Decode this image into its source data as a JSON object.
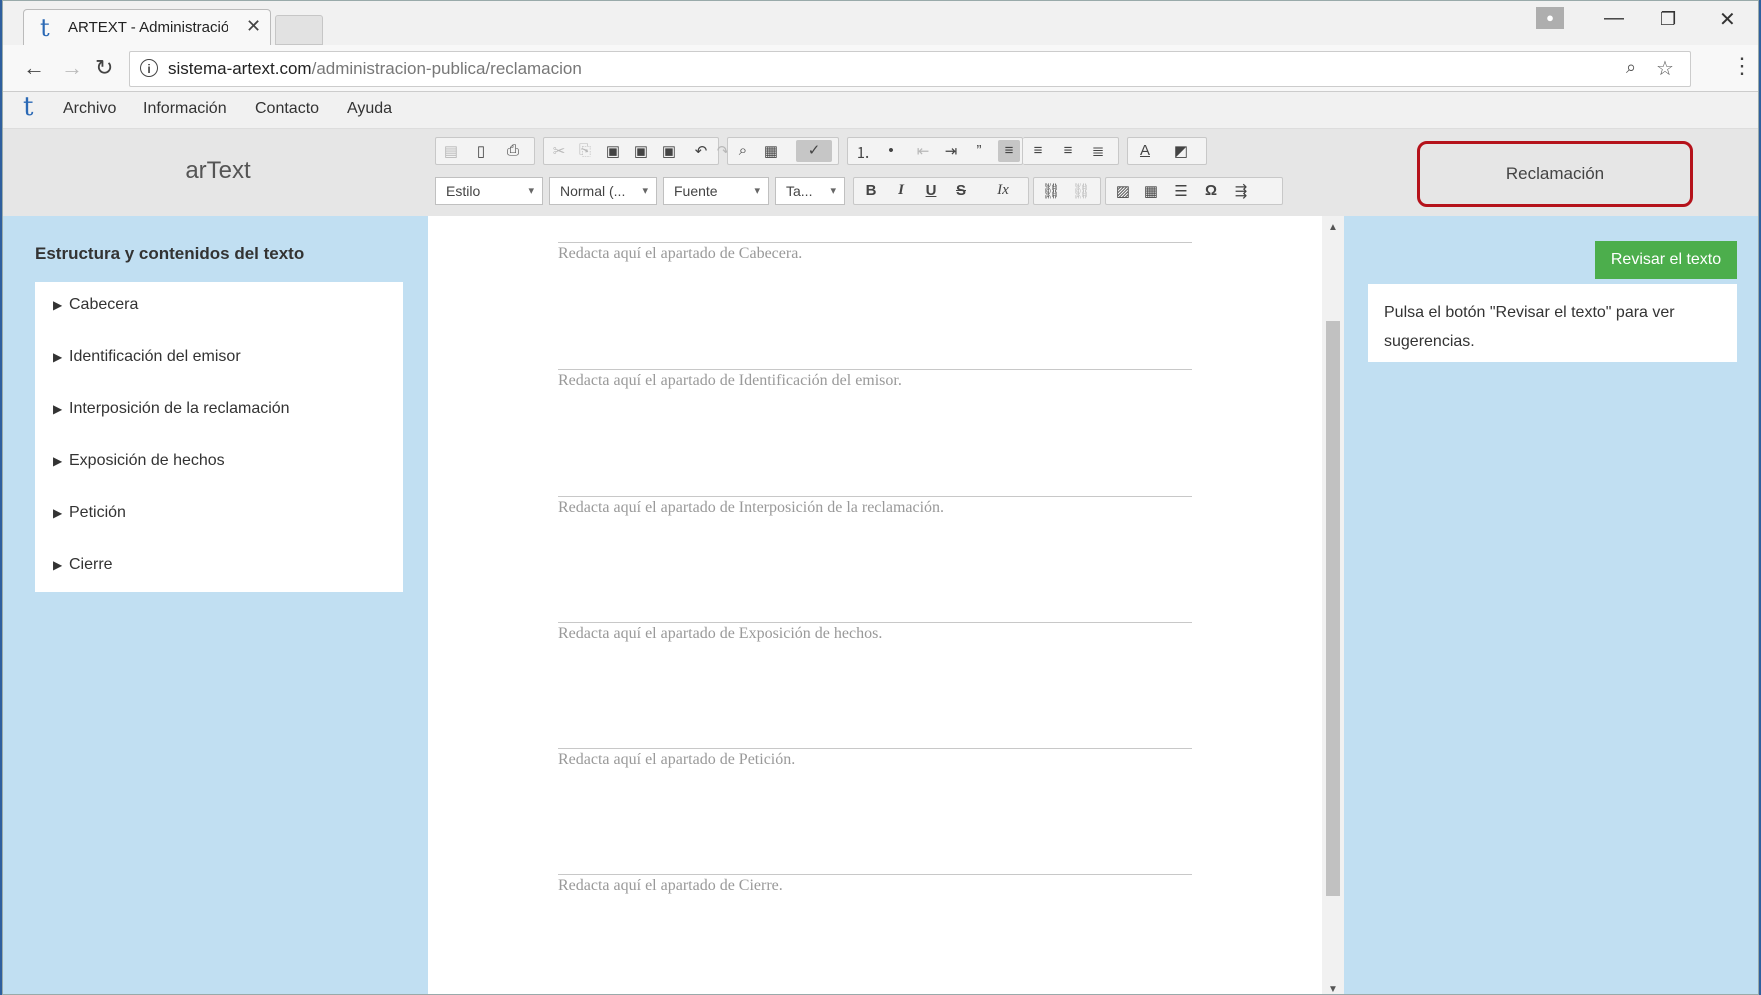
{
  "browser": {
    "tab_title": "ARTEXT - Administración",
    "tab_icon": "t",
    "url_host": "sistema-artext.com",
    "url_path": "/administracion-publica/reclamacion"
  },
  "menu": {
    "logo": "t",
    "items": [
      "Archivo",
      "Información",
      "Contacto",
      "Ayuda"
    ]
  },
  "header": {
    "app_name": "arText",
    "mode_label": "Reclamación",
    "accent_color": "#b5121b"
  },
  "editor_toolbar": {
    "style_label": "Estilo",
    "format_label": "Normal (...",
    "font_label": "Fuente",
    "size_label": "Ta...",
    "bold": "B",
    "italic": "I",
    "underline": "U",
    "strike": "S",
    "omega": "Ω"
  },
  "left_panel": {
    "title": "Estructura y contenidos del texto",
    "items": [
      "Cabecera",
      "Identificación del emisor",
      "Interposición de la reclamación",
      "Exposición de hechos",
      "Petición",
      "Cierre"
    ]
  },
  "editor": {
    "sections": [
      "Redacta aquí el apartado de Cabecera.",
      "Redacta aquí el apartado de Identificación del emisor.",
      "Redacta aquí el apartado de Interposición de la reclamación.",
      "Redacta aquí el apartado de Exposición de hechos.",
      "Redacta aquí el apartado de Petición.",
      "Redacta aquí el apartado de Cierre."
    ]
  },
  "right_panel": {
    "review_button": "Revisar el texto",
    "review_button_color": "#4cae4c",
    "suggestion_text": "Pulsa el botón \"Revisar el texto\" para ver sugerencias."
  },
  "panel_color": "#c1dff2"
}
